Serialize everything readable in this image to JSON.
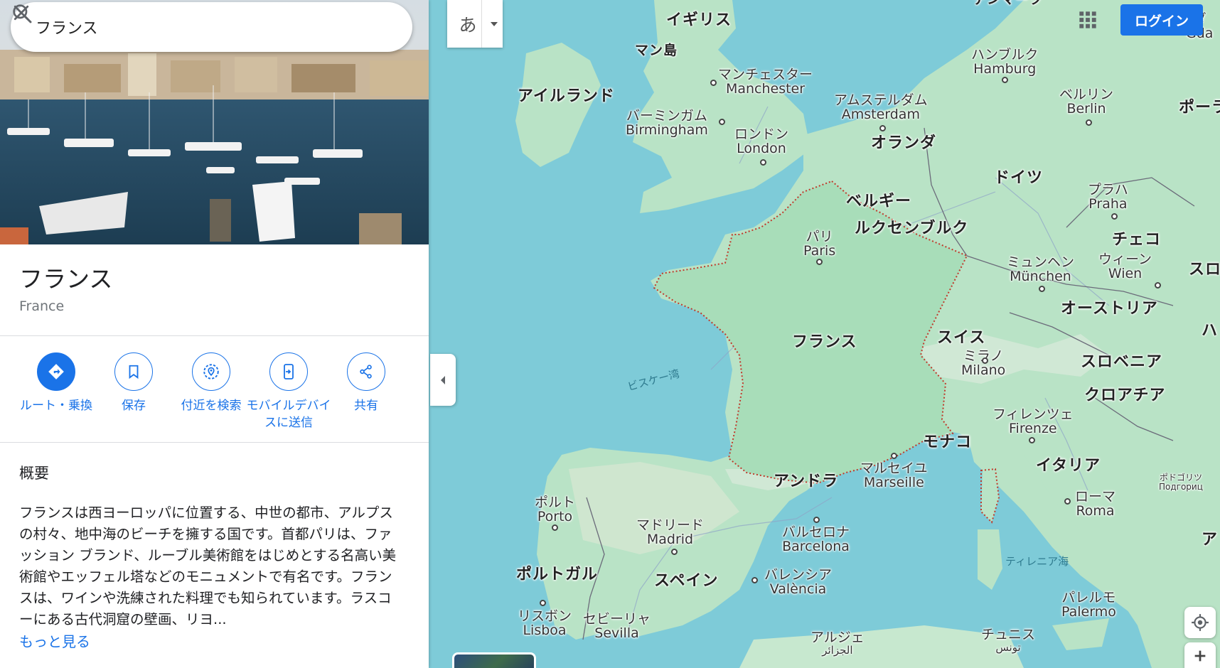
{
  "search": {
    "value": "フランス"
  },
  "place": {
    "title": "フランス",
    "subtitle": "France"
  },
  "actions": [
    {
      "label": "ルート・乗換",
      "icon": "directions-icon"
    },
    {
      "label": "保存",
      "icon": "bookmark-icon"
    },
    {
      "label": "付近を検索",
      "icon": "nearby-icon"
    },
    {
      "label": "モバイルデバイスに送信",
      "icon": "send-to-phone-icon"
    },
    {
      "label": "共有",
      "icon": "share-icon"
    }
  ],
  "overview": {
    "heading": "概要",
    "text": "フランスは西ヨーロッパに位置する、中世の都市、アルプスの村々、地中海のビーチを擁する国です。首都パリは、ファッション ブランド、ルーブル美術館をはじめとする名高い美術館やエッフェル塔などのモニュメントで有名です。フランスは、ワインや洗練された料理でも知られています。ラスコーにある古代洞窟の壁画、リヨ...",
    "more": "もっと見る"
  },
  "controls": {
    "ime_char": "あ",
    "login": "ログイン"
  },
  "colors": {
    "accent": "#1a73e8",
    "sea": "#7ecbd8",
    "land": "#b9e3c6",
    "border_france": "#c0392b"
  },
  "map": {
    "countries": [
      "イギリス",
      "マン島",
      "アイルランド",
      "オランダ",
      "ドイツ",
      "ベルギー",
      "ルクセンブルク",
      "チェコ",
      "オーストリア",
      "スイス",
      "スロベニア",
      "クロアチア",
      "フランス",
      "モナコ",
      "イタリア",
      "アンドラ",
      "ポルトガル",
      "スペイン",
      "ポーラ",
      "スロ",
      "ハ",
      "ア",
      "テンマーク"
    ],
    "cities": [
      {
        "jp": "マンチェスター",
        "en": "Manchester"
      },
      {
        "jp": "バーミンガム",
        "en": "Birmingham"
      },
      {
        "jp": "ロンドン",
        "en": "London"
      },
      {
        "jp": "アムステルダム",
        "en": "Amsterdam"
      },
      {
        "jp": "ハンブルク",
        "en": "Hamburg"
      },
      {
        "jp": "ベルリン",
        "en": "Berlin"
      },
      {
        "jp": "プラハ",
        "en": "Praha"
      },
      {
        "jp": "パリ",
        "en": "Paris"
      },
      {
        "jp": "ミュンヘン",
        "en": "München"
      },
      {
        "jp": "ウィーン",
        "en": "Wien"
      },
      {
        "jp": "ミラノ",
        "en": "Milano"
      },
      {
        "jp": "フィレンツェ",
        "en": "Firenze"
      },
      {
        "jp": "マルセイユ",
        "en": "Marseille"
      },
      {
        "jp": "ポルト",
        "en": "Porto"
      },
      {
        "jp": "マドリード",
        "en": "Madrid"
      },
      {
        "jp": "バルセロナ",
        "en": "Barcelona"
      },
      {
        "jp": "ローマ",
        "en": "Roma"
      },
      {
        "jp": "バレンシア",
        "en": "València"
      },
      {
        "jp": "リスボン",
        "en": "Lisboa"
      },
      {
        "jp": "セビーリャ",
        "en": "Sevilla"
      },
      {
        "jp": "パレルモ",
        "en": "Palermo"
      },
      {
        "jp": "アルジェ",
        "en": "الجزائر"
      },
      {
        "jp": "チュニス",
        "en": "تونس"
      },
      {
        "jp": "ダ",
        "en": "Gda"
      },
      {
        "jp": "ポドゴリツ",
        "en": "Подгориц"
      }
    ],
    "seas": [
      "ビスケー湾",
      "ティレニア海"
    ]
  }
}
